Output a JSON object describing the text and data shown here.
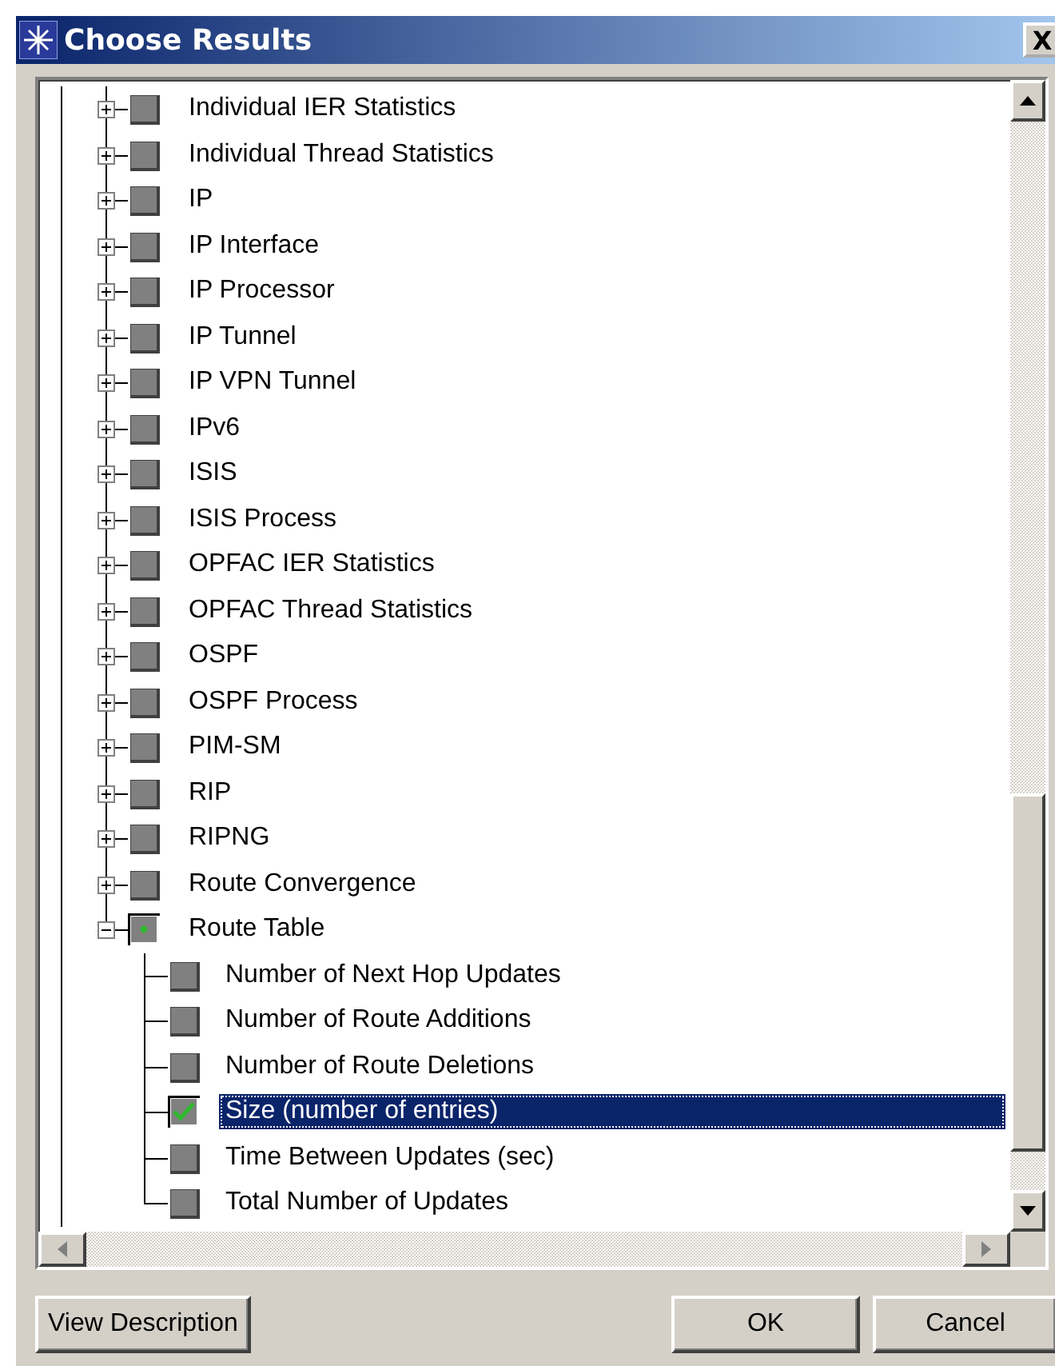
{
  "window": {
    "title": "Choose Results",
    "close_label": "X"
  },
  "tree": [
    {
      "label": "Individual IER Statistics",
      "expanded": false,
      "checked": false,
      "partial": false
    },
    {
      "label": "Individual Thread Statistics",
      "expanded": false,
      "checked": false,
      "partial": false
    },
    {
      "label": "IP",
      "expanded": false,
      "checked": false,
      "partial": false
    },
    {
      "label": "IP Interface",
      "expanded": false,
      "checked": false,
      "partial": false
    },
    {
      "label": "IP Processor",
      "expanded": false,
      "checked": false,
      "partial": false
    },
    {
      "label": "IP Tunnel",
      "expanded": false,
      "checked": false,
      "partial": false
    },
    {
      "label": "IP VPN Tunnel",
      "expanded": false,
      "checked": false,
      "partial": false
    },
    {
      "label": "IPv6",
      "expanded": false,
      "checked": false,
      "partial": false
    },
    {
      "label": "ISIS",
      "expanded": false,
      "checked": false,
      "partial": false
    },
    {
      "label": "ISIS Process",
      "expanded": false,
      "checked": false,
      "partial": false
    },
    {
      "label": "OPFAC IER Statistics",
      "expanded": false,
      "checked": false,
      "partial": false
    },
    {
      "label": "OPFAC Thread Statistics",
      "expanded": false,
      "checked": false,
      "partial": false
    },
    {
      "label": "OSPF",
      "expanded": false,
      "checked": false,
      "partial": false
    },
    {
      "label": "OSPF Process",
      "expanded": false,
      "checked": false,
      "partial": false
    },
    {
      "label": "PIM-SM",
      "expanded": false,
      "checked": false,
      "partial": false
    },
    {
      "label": "RIP",
      "expanded": false,
      "checked": false,
      "partial": false
    },
    {
      "label": "RIPNG",
      "expanded": false,
      "checked": false,
      "partial": false
    },
    {
      "label": "Route Convergence",
      "expanded": false,
      "checked": false,
      "partial": false
    },
    {
      "label": "Route Table",
      "expanded": true,
      "checked": false,
      "partial": true,
      "children": [
        {
          "label": "Number of Next Hop Updates",
          "checked": false,
          "partial": false,
          "selected": false
        },
        {
          "label": "Number of Route Additions",
          "checked": false,
          "partial": false,
          "selected": false
        },
        {
          "label": "Number of Route Deletions",
          "checked": false,
          "partial": false,
          "selected": false
        },
        {
          "label": "Size (number of entries)",
          "checked": true,
          "partial": false,
          "selected": true
        },
        {
          "label": "Time Between Updates (sec)",
          "checked": false,
          "partial": false,
          "selected": false
        },
        {
          "label": "Total Number of Updates",
          "checked": false,
          "partial": false,
          "selected": false
        }
      ]
    }
  ],
  "buttons": [
    {
      "label": "View Description"
    },
    {
      "label": "OK"
    },
    {
      "label": "Cancel"
    }
  ]
}
